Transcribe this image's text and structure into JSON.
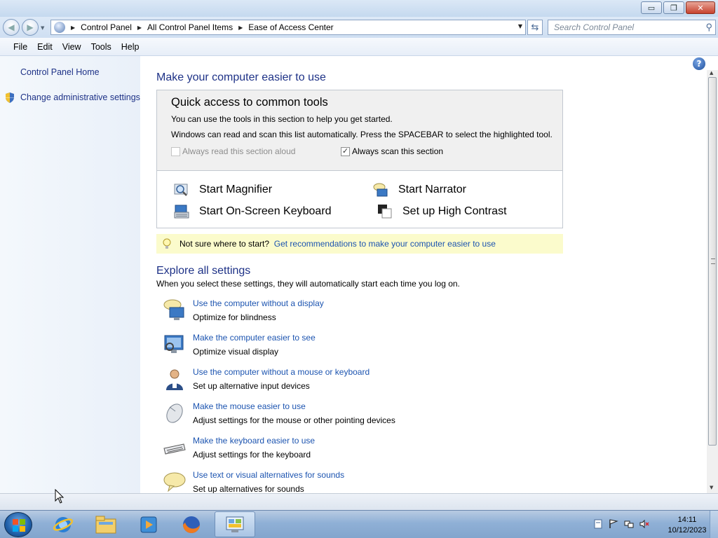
{
  "window": {
    "minimize_label": "▭",
    "maximize_label": "❐",
    "close_label": "✕"
  },
  "address": {
    "crumbs": [
      "Control Panel",
      "All Control Panel Items",
      "Ease of Access Center"
    ],
    "search_placeholder": "Search Control Panel"
  },
  "menu": [
    "File",
    "Edit",
    "View",
    "Tools",
    "Help"
  ],
  "sidebar": {
    "home": "Control Panel Home",
    "admin": "Change administrative settings"
  },
  "main": {
    "title": "Make your computer easier to use",
    "quick_access": {
      "title": "Quick access to common tools",
      "line1": "You can use the tools in this section to help you get started.",
      "line2": "Windows can read and scan this list automatically.  Press the SPACEBAR to select the highlighted tool.",
      "read_aloud": {
        "label": "Always read this section aloud",
        "checked": false,
        "enabled": false
      },
      "scan": {
        "label": "Always scan this section",
        "checked": true,
        "enabled": true
      },
      "tools": [
        {
          "label": "Start Magnifier",
          "icon": "magnifier-icon"
        },
        {
          "label": "Start Narrator",
          "icon": "narrator-icon"
        },
        {
          "label": "Start On-Screen Keyboard",
          "icon": "onscreen-keyboard-icon"
        },
        {
          "label": "Set up High Contrast",
          "icon": "high-contrast-icon"
        }
      ]
    },
    "tip": {
      "prefix": "Not sure where to start?",
      "link": "Get recommendations to make your computer easier to use"
    },
    "explore": {
      "title": "Explore all settings",
      "subtitle": "When you select these settings, they will automatically start each time you log on.",
      "items": [
        {
          "title": "Use the computer without a display",
          "desc": "Optimize for blindness",
          "icon": "speech-monitor-icon"
        },
        {
          "title": "Make the computer easier to see",
          "desc": "Optimize visual display",
          "icon": "monitor-icon"
        },
        {
          "title": "Use the computer without a mouse or keyboard",
          "desc": "Set up alternative input devices",
          "icon": "user-icon"
        },
        {
          "title": "Make the mouse easier to use",
          "desc": "Adjust settings for the mouse or other pointing devices",
          "icon": "mouse-icon"
        },
        {
          "title": "Make the keyboard easier to use",
          "desc": "Adjust settings for the keyboard",
          "icon": "keyboard-icon"
        },
        {
          "title": "Use text or visual alternatives for sounds",
          "desc": "Set up alternatives for sounds",
          "icon": "speech-bubble-icon"
        }
      ]
    }
  },
  "taskbar": {
    "time": "14:11",
    "date": "10/12/2023"
  }
}
